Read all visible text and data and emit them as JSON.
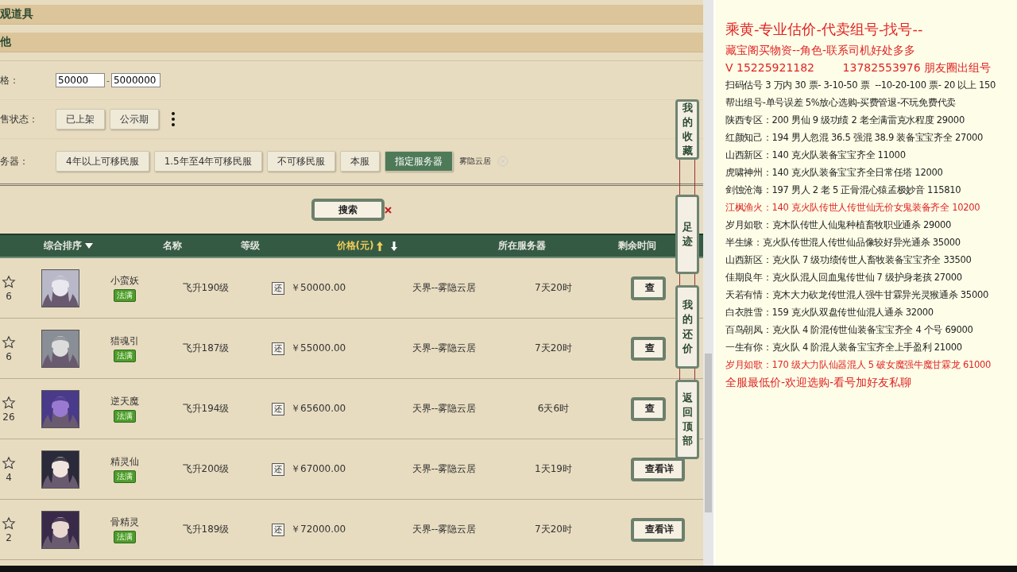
{
  "sections": [
    {
      "title": "观道具"
    },
    {
      "title": "他"
    }
  ],
  "filters": {
    "price": {
      "label": "格：",
      "min": "50000",
      "separator": "-",
      "max": "5000000"
    },
    "sale_status": {
      "label": "售状态：",
      "options": [
        {
          "label": "已上架",
          "selected": false
        },
        {
          "label": "公示期",
          "selected": false
        }
      ]
    },
    "server": {
      "label": "务器：",
      "options": [
        {
          "label": "4年以上可移民服",
          "selected": false
        },
        {
          "label": "1.5年至4年可移民服",
          "selected": false
        },
        {
          "label": "不可移民服",
          "selected": false
        },
        {
          "label": "本服",
          "selected": false
        },
        {
          "label": "指定服务器",
          "selected": true
        }
      ],
      "chosen": "雾隐云居"
    }
  },
  "search_button": "搜索",
  "table": {
    "columns": [
      {
        "label": "综合排序",
        "selected": false,
        "kind": "dropdown"
      },
      {
        "label": "名称",
        "selected": false,
        "kind": "plain"
      },
      {
        "label": "等级",
        "selected": false,
        "kind": "plain"
      },
      {
        "label": "价格(元)",
        "selected": true,
        "kind": "sortable"
      },
      {
        "label": "所在服务器",
        "selected": false,
        "kind": "plain"
      },
      {
        "label": "剩余时间",
        "selected": false,
        "kind": "plain"
      }
    ],
    "rows": [
      {
        "favorites": "6",
        "name": "小蛮妖",
        "tag": "法满",
        "level": "飞升190级",
        "bargain": "还",
        "price": "￥50000.00",
        "server": "天界--雾隐云居",
        "time_left": "7天20时",
        "action": "查"
      },
      {
        "favorites": "6",
        "name": "猎魂引",
        "tag": "法满",
        "level": "飞升187级",
        "bargain": "还",
        "price": "￥55000.00",
        "server": "天界--雾隐云居",
        "time_left": "7天20时",
        "action": "查"
      },
      {
        "favorites": "26",
        "name": "逆天魔",
        "tag": "法满",
        "level": "飞升194级",
        "bargain": "还",
        "price": "￥65600.00",
        "server": "天界--雾隐云居",
        "time_left": "6天6时",
        "action": "查"
      },
      {
        "favorites": "4",
        "name": "精灵仙",
        "tag": "法满",
        "level": "飞升200级",
        "bargain": "还",
        "price": "￥67000.00",
        "server": "天界--雾隐云居",
        "time_left": "1天19时",
        "action": "查看详"
      },
      {
        "favorites": "2",
        "name": "骨精灵",
        "tag": "法满",
        "level": "飞升189级",
        "bargain": "还",
        "price": "￥72000.00",
        "server": "天界--雾隐云居",
        "time_left": "7天20时",
        "action": "查看详"
      }
    ]
  },
  "side_tabs": [
    {
      "label": "我的收藏"
    },
    {
      "label": "足迹"
    },
    {
      "label": "我的还价"
    },
    {
      "label": "返回顶部"
    }
  ],
  "notes": [
    {
      "kind": "title",
      "color": "#e02424",
      "text": "乘黄-专业估价-代卖组号-找号--"
    },
    {
      "kind": "large",
      "color": "#e02424",
      "text": "藏宝阁买物资--角色-联系司机好处多多"
    },
    {
      "kind": "large",
      "color": "#e02424",
      "text": "V 15225921182        13782553976 朋友圈出组号"
    },
    {
      "kind": "line",
      "color": "#222222",
      "text": "扫码估号 3 万内 30 票- 3-10-50 票  --10-20-100 票- 20 以上 150"
    },
    {
      "kind": "line",
      "color": "#222222",
      "text": "帮出组号-单号误差 5%放心选购-买费管退-不玩免费代卖"
    },
    {
      "kind": "line",
      "color": "#222222",
      "text": "陕西专区：200 男仙 9 级功绩 2 老全满雷克水程度 29000"
    },
    {
      "kind": "line",
      "color": "#222222",
      "text": "红颜知己：194 男人忽混 36.5 强混 38.9 装备宝宝齐全 27000"
    },
    {
      "kind": "line",
      "color": "#222222",
      "text": "山西新区：140 克火队装备宝宝齐全 11000"
    },
    {
      "kind": "line",
      "color": "#222222",
      "text": "虎啸神州：140 克火队装备宝宝齐全日常任塔 12000"
    },
    {
      "kind": "line",
      "color": "#222222",
      "text": "剑蚀沧海：197 男人 2 老 5 正骨混心猿孟极妙音 115810"
    },
    {
      "kind": "line",
      "color": "#e02424",
      "text": "江枫渔火：140 克火队传世人传世仙无价女鬼装备齐全 10200"
    },
    {
      "kind": "line",
      "color": "#222222",
      "text": "岁月如歌：克木队传世人仙鬼种植畜牧职业通杀 29000"
    },
    {
      "kind": "line",
      "color": "#222222",
      "text": "半生缘：克火队传世混人传世仙品像较好异光通杀 35000"
    },
    {
      "kind": "line",
      "color": "#222222",
      "text": "山西新区：克火队 7 级功绩传世人畜牧装备宝宝齐全 33500"
    },
    {
      "kind": "line",
      "color": "#222222",
      "text": "佳期良年：克火队混人回血鬼传世仙 7 级护身老孩 27000"
    },
    {
      "kind": "line",
      "color": "#222222",
      "text": "天若有情：克木大力砍龙传世混人强牛甘霖异光灵猴通杀 35000"
    },
    {
      "kind": "line",
      "color": "#222222",
      "text": "白衣胜雪：159 克火队双盘传世仙混人通杀 32000"
    },
    {
      "kind": "line",
      "color": "#222222",
      "text": "百鸟朝凤：克火队 4 阶混传世仙装备宝宝齐全 4 个号 69000"
    },
    {
      "kind": "line",
      "color": "#222222",
      "text": "一生有你：克火队 4 阶混人装备宝宝齐全上手盈利 21000"
    },
    {
      "kind": "line",
      "color": "#e02424",
      "text": "岁月如歌：170 级大力队仙器混人 5 破女魔强牛魔甘霖龙 61000"
    },
    {
      "kind": "large",
      "color": "#e02424",
      "text": "全服最低价-欢迎选购-看号加好友私聊"
    }
  ]
}
